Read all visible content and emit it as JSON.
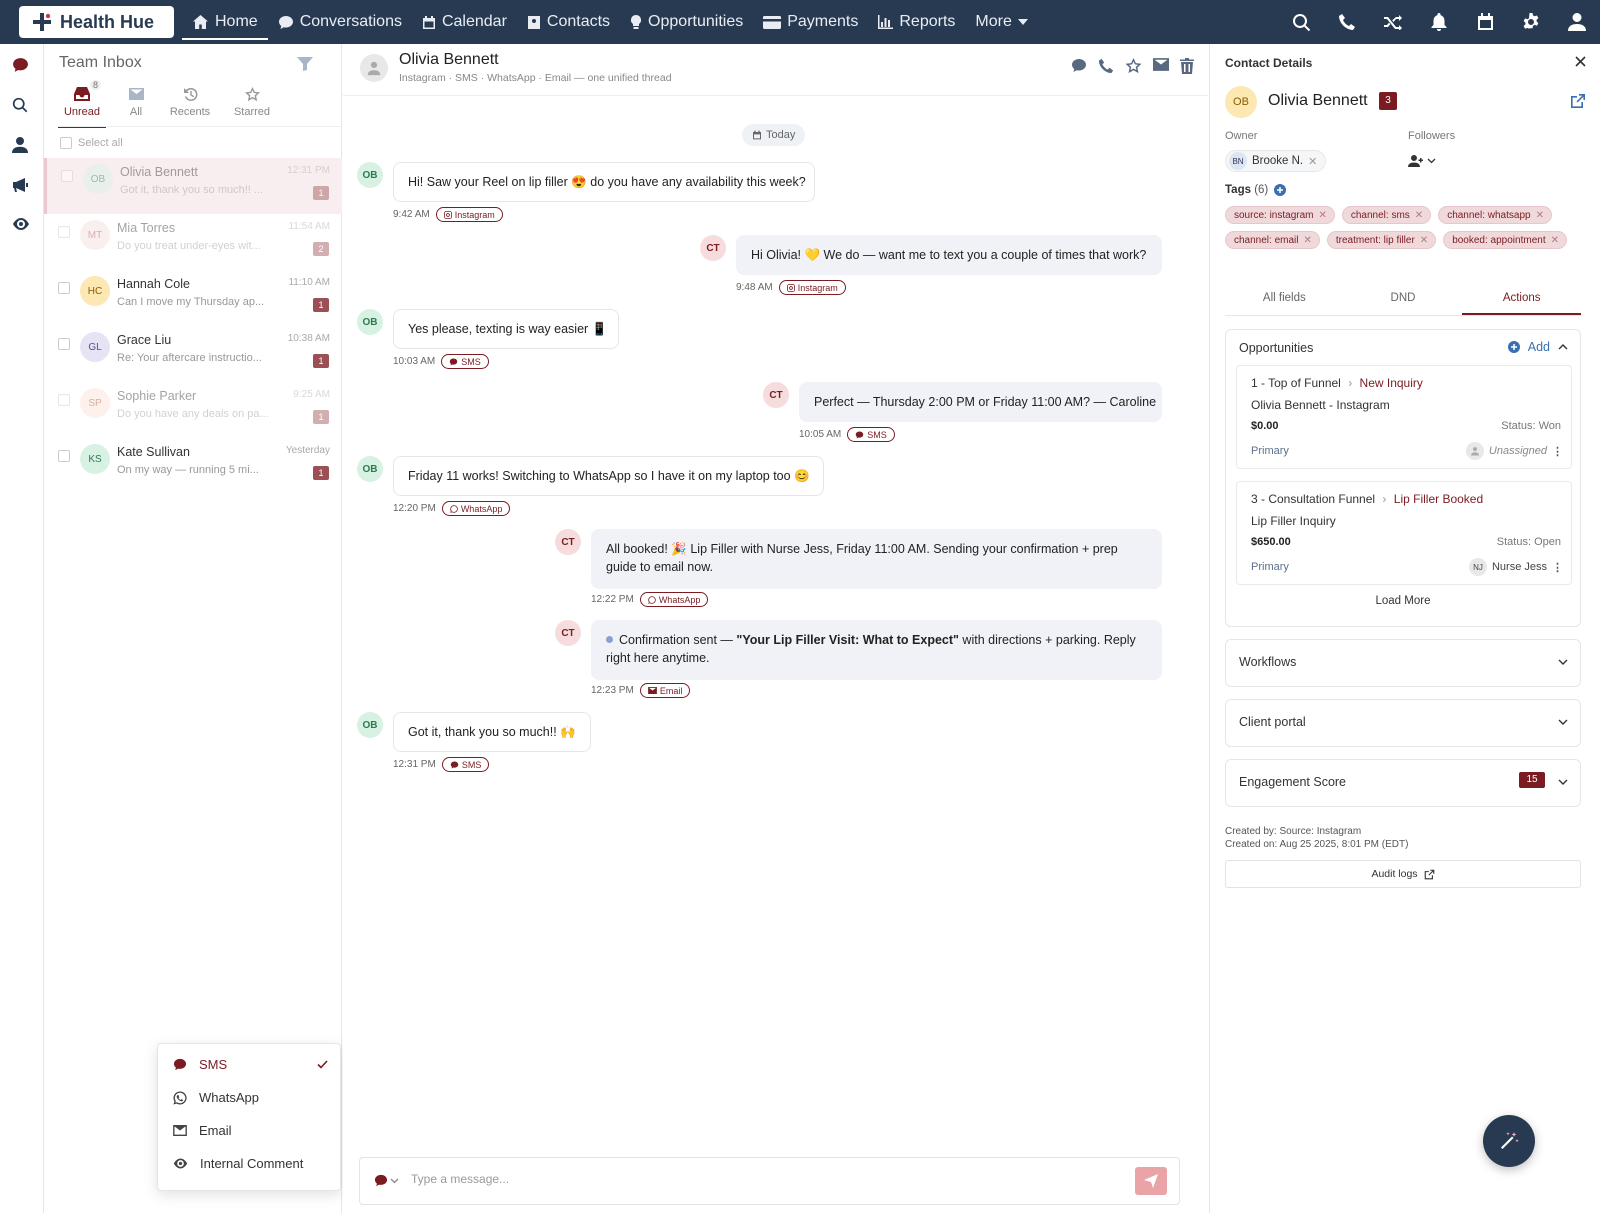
{
  "brand": {
    "name": "Health Hue"
  },
  "nav": {
    "items": [
      {
        "label": "Home",
        "icon": "home-icon"
      },
      {
        "label": "Conversations",
        "icon": "chat-icon"
      },
      {
        "label": "Calendar",
        "icon": "calendar-icon"
      },
      {
        "label": "Contacts",
        "icon": "contacts-icon"
      },
      {
        "label": "Opportunities",
        "icon": "lightbulb-icon"
      },
      {
        "label": "Payments",
        "icon": "credit-card-icon"
      },
      {
        "label": "Reports",
        "icon": "bar-chart-icon"
      },
      {
        "label": "More",
        "icon": "caret-down-icon"
      }
    ],
    "right_icons": [
      "search-icon",
      "phone-icon",
      "shuffle-icon",
      "bell-icon",
      "calendar-icon",
      "gear-icon",
      "user-icon"
    ]
  },
  "rail_icons": [
    "chat-icon",
    "search-icon",
    "user-icon",
    "megaphone-icon",
    "eye-icon"
  ],
  "inbox": {
    "title": "Team Inbox",
    "tabs": [
      {
        "label": "Unread",
        "badge": "8",
        "icon": "inbox-icon"
      },
      {
        "label": "All",
        "icon": "mail-icon"
      },
      {
        "label": "Recents",
        "icon": "history-icon"
      },
      {
        "label": "Starred",
        "icon": "star-icon"
      }
    ],
    "select_all": "Select all",
    "conversations": [
      {
        "initials": "OB",
        "name": "Olivia Bennett",
        "preview": "Got it, thank you so much!! ...",
        "time": "12:31 PM",
        "count": "1",
        "faded": true,
        "selected": true,
        "bg": "#d7f2e3",
        "fg": "#2e7a53"
      },
      {
        "initials": "MT",
        "name": "Mia Torres",
        "preview": "Do you treat under-eyes wit...",
        "time": "11:54 AM",
        "count": "2",
        "faded": true,
        "bg": "#f6dcdd",
        "fg": "#b44a55"
      },
      {
        "initials": "HC",
        "name": "Hannah Cole",
        "preview": "Can I move my Thursday ap...",
        "time": "11:10 AM",
        "count": "1",
        "bg": "#fde7b3",
        "fg": "#8a5a00"
      },
      {
        "initials": "GL",
        "name": "Grace Liu",
        "preview": "Re: Your aftercare instructio...",
        "time": "10:38 AM",
        "count": "1",
        "bg": "#e6e3f5",
        "fg": "#5a4e8a"
      },
      {
        "initials": "SP",
        "name": "Sophie Parker",
        "preview": "Do you have any deals on pa...",
        "time": "9:25 AM",
        "count": "1",
        "faded": true,
        "bg": "#fde2d3",
        "fg": "#a3532d"
      },
      {
        "initials": "KS",
        "name": "Kate Sullivan",
        "preview": "On my way — running 5 mi...",
        "time": "Yesterday",
        "count": "1",
        "bg": "#d7f2e3",
        "fg": "#2e7a53"
      }
    ]
  },
  "channel_menu": {
    "items": [
      {
        "label": "SMS",
        "icon": "sms-icon",
        "checked": true
      },
      {
        "label": "WhatsApp",
        "icon": "whatsapp-icon"
      },
      {
        "label": "Email",
        "icon": "mail-icon"
      },
      {
        "label": "Internal Comment",
        "icon": "eye-icon"
      }
    ]
  },
  "chat": {
    "name": "Olivia Bennett",
    "subtitle": "Instagram · SMS · WhatsApp · Email — one unified thread",
    "date_pill": "Today",
    "messages": [
      {
        "from": "OB",
        "text": "Hi! Saw your Reel on lip filler 😍 do you have any availability this week?",
        "time": "9:42 AM",
        "channel": "Instagram"
      },
      {
        "from": "CT",
        "text": "Hi Olivia! 💛 We do — want me to text you a couple of times that work?",
        "time": "9:48 AM",
        "channel": "Instagram"
      },
      {
        "from": "OB",
        "text": "Yes please, texting is way easier 📱",
        "time": "10:03 AM",
        "channel": "SMS"
      },
      {
        "from": "CT",
        "text": "Perfect — Thursday 2:00 PM or Friday 11:00 AM? — Caroline",
        "time": "10:05 AM",
        "channel": "SMS"
      },
      {
        "from": "OB",
        "text": "Friday 11 works! Switching to WhatsApp so I have it on my laptop too 😊",
        "time": "12:20 PM",
        "channel": "WhatsApp"
      },
      {
        "from": "CT",
        "text": "All booked! 🎉 Lip Filler with Nurse Jess, Friday 11:00 AM. Sending your confirmation + prep guide to email now.",
        "time": "12:22 PM",
        "channel": "WhatsApp"
      },
      {
        "from": "CT",
        "text_pre": "Confirmation sent — ",
        "text_bold": "\"Your Lip Filler Visit: What to Expect\"",
        "text_post": " with directions + parking. Reply right here anytime.",
        "time": "12:23 PM",
        "channel": "Email"
      },
      {
        "from": "OB",
        "text": "Got it, thank you so much!! 🙌",
        "time": "12:31 PM",
        "channel": "SMS"
      }
    ],
    "composer_placeholder": "Type a message..."
  },
  "contact": {
    "header": "Contact Details",
    "initials": "OB",
    "name": "Olivia Bennett",
    "badge": "3",
    "owner_label": "Owner",
    "owner_initials": "BN",
    "owner_name": "Brooke N.",
    "followers_label": "Followers",
    "tags_label": "Tags",
    "tags_count": "(6)",
    "tags": [
      "source: instagram",
      "channel: sms",
      "channel: whatsapp",
      "channel: email",
      "treatment: lip filler",
      "booked: appointment"
    ],
    "tabs": [
      "All fields",
      "DND",
      "Actions"
    ],
    "opportunities": {
      "title": "Opportunities",
      "add_label": "Add",
      "items": [
        {
          "pipeline": "1 - Top of Funnel",
          "stage": "New Inquiry",
          "name": "Olivia Bennett - Instagram",
          "value": "$0.00",
          "status": "Status: Won",
          "primary": "Primary",
          "assignee": "Unassigned",
          "assignee_initials": ""
        },
        {
          "pipeline": "3 - Consultation Funnel",
          "stage": "Lip Filler Booked",
          "name": "Lip Filler Inquiry",
          "value": "$650.00",
          "status": "Status: Open",
          "primary": "Primary",
          "assignee": "Nurse Jess",
          "assignee_initials": "NJ"
        }
      ],
      "load_more": "Load More"
    },
    "workflows": "Workflows",
    "client_portal": "Client portal",
    "engagement": "Engagement Score",
    "engagement_score": "15",
    "created_by": "Created by: Source: Instagram",
    "created_on": "Created on: Aug 25 2025, 8:01 PM (EDT)",
    "audit_logs": "Audit logs"
  },
  "colors": {
    "nav_bg": "#283a52",
    "accent": "#7a1c22",
    "tag_bg": "#f0d9db"
  }
}
